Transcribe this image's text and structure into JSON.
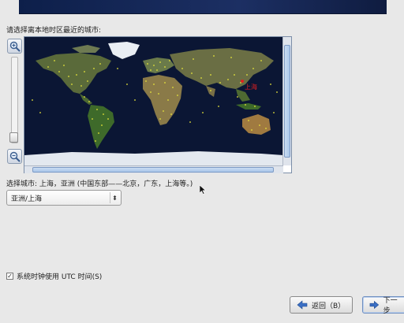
{
  "prompt": "请选择离本地时区最近的城市:",
  "map": {
    "selected_city_marker": "上海",
    "zoom_in_icon": "zoom-in-icon",
    "zoom_out_icon": "zoom-out-icon"
  },
  "selected_city_label": "选择城市: 上海，亚洲 (中国东部——北京，广东，上海等。)",
  "timezone_combo": {
    "value": "亚洲/上海",
    "arrow": "⬍"
  },
  "utc_checkbox": {
    "checked": true,
    "label": "系统时钟使用 UTC 时间(S)"
  },
  "buttons": {
    "back": "返回（B）",
    "next": "下一步"
  },
  "colors": {
    "ocean": "#0b1634",
    "city_dot": "#e8e63a",
    "selected_city": "#e02020"
  }
}
